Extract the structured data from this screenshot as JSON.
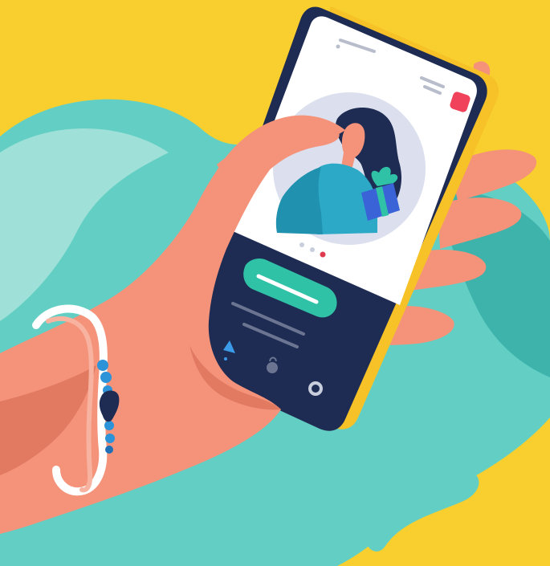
{
  "colors": {
    "background": "#F8CF2F",
    "blob_teal": "#63CFC4",
    "blob_teal_light": "#9FE1D8",
    "blob_teal_dark": "#3DB3AC",
    "skin": "#F4937A",
    "skin_shadow": "#E27A62",
    "phone_body": "#F6C227",
    "phone_frame": "#1E2B52",
    "screen_bg": "#FFFFFF",
    "screen_panel": "#1E2B52",
    "cta_button": "#2FC2A6",
    "avatar_circle": "#DCE0EE",
    "figure_hair": "#1E2B52",
    "figure_top": "#2BA9C7",
    "gift_box": "#3B63D8",
    "gift_ribbon": "#2FC2A6",
    "notification_badge": "#F0425A",
    "bracelet_white": "#FFFFFF",
    "bracelet_blue": "#2C93D9",
    "bracelet_charm": "#1E2B52"
  },
  "phone": {
    "carousel": {
      "slide_count": 3,
      "active_slide": 3
    },
    "bottom_nav": {
      "items": [
        {
          "icon": "home-icon",
          "active": true
        },
        {
          "icon": "bag-icon",
          "active": false
        },
        {
          "icon": "profile-icon",
          "active": false
        }
      ]
    }
  }
}
